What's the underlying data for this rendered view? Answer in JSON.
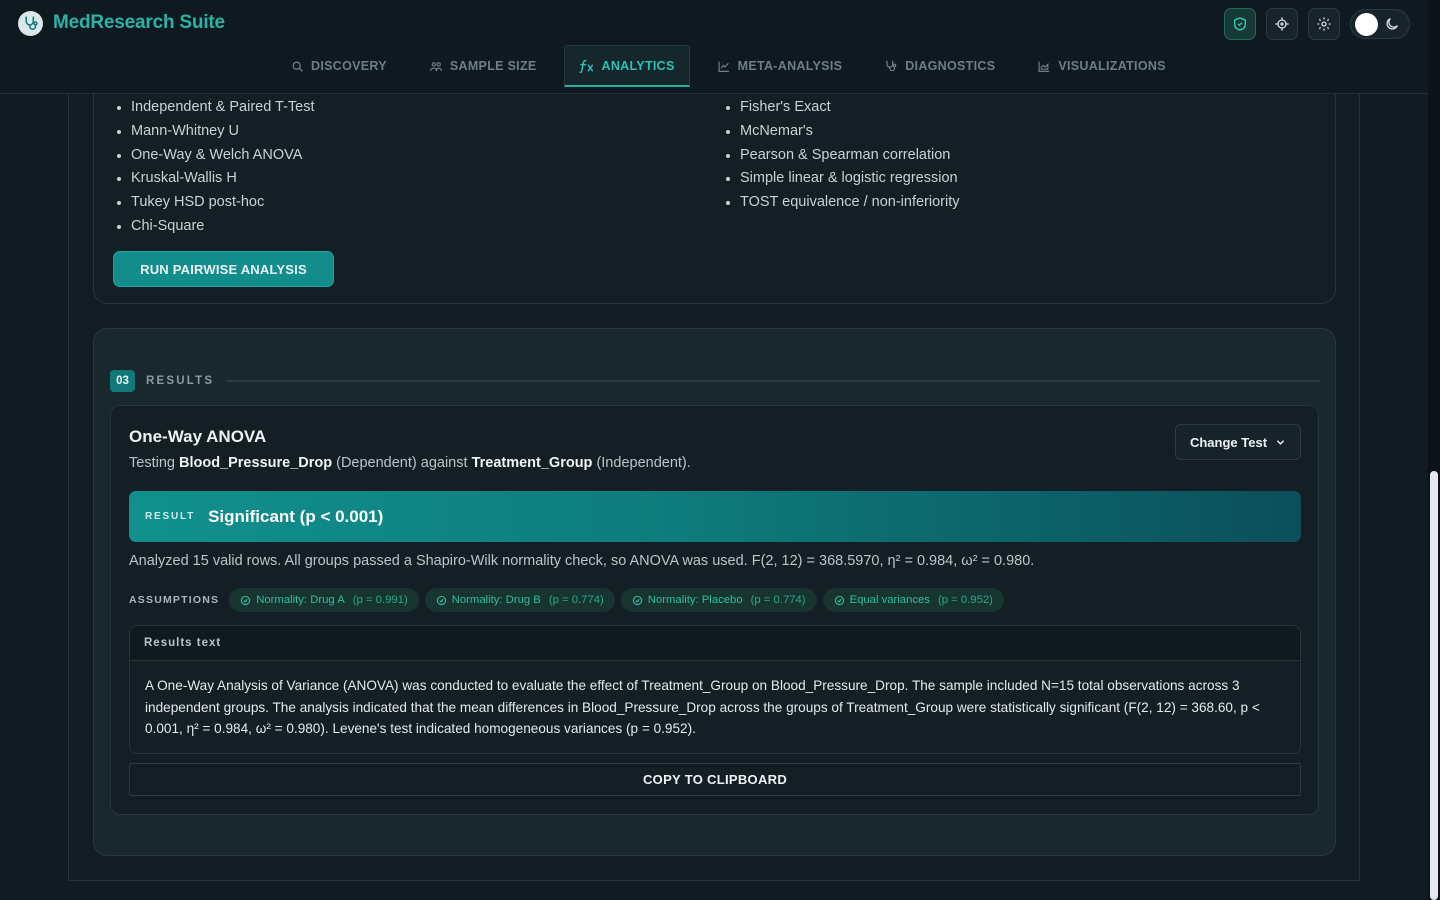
{
  "app": {
    "title": "MedResearch Suite"
  },
  "nav": {
    "tabs": [
      {
        "label": "DISCOVERY",
        "icon": "search-icon",
        "active": false
      },
      {
        "label": "SAMPLE SIZE",
        "icon": "users-icon",
        "active": false
      },
      {
        "label": "ANALYTICS",
        "icon": "function-icon",
        "active": true
      },
      {
        "label": "META-ANALYSIS",
        "icon": "line-chart-icon",
        "active": false
      },
      {
        "label": "DIAGNOSTICS",
        "icon": "stethoscope-icon",
        "active": false
      },
      {
        "label": "VISUALIZATIONS",
        "icon": "area-chart-icon",
        "active": false
      }
    ]
  },
  "header_actions": {
    "shield": "shield-icon",
    "target": "crosshair-icon",
    "settings": "gear-icon",
    "theme": "moon-icon"
  },
  "tests": {
    "left": [
      "Independent & Paired T-Test",
      "Mann-Whitney U",
      "One-Way & Welch ANOVA",
      "Kruskal-Wallis H",
      "Tukey HSD post-hoc",
      "Chi-Square"
    ],
    "right": [
      "Fisher's Exact",
      "McNemar's",
      "Pearson & Spearman correlation",
      "Simple linear & logistic regression",
      "TOST equivalence / non-inferiority"
    ],
    "run_button": "RUN PAIRWISE ANALYSIS"
  },
  "results": {
    "section_number": "03",
    "section_label": "RESULTS",
    "test_name": "One-Way ANOVA",
    "desc_prefix": "Testing",
    "dependent_var": "Blood_Pressure_Drop",
    "desc_dependent": "(Dependent) against",
    "independent_var": "Treatment_Group",
    "desc_independent": "(Independent).",
    "change_test_label": "Change Test",
    "banner_label": "RESULT",
    "banner_value": "Significant (p < 0.001)",
    "analyzed_text": "Analyzed 15 valid rows. All groups passed a Shapiro-Wilk normality check, so ANOVA was used. F(2, 12) = 368.5970, η² = 0.984, ω² = 0.980.",
    "assumptions_label": "ASSUMPTIONS",
    "assumptions": [
      {
        "label": "Normality: Drug A",
        "p": "(p = 0.991)"
      },
      {
        "label": "Normality: Drug B",
        "p": "(p = 0.774)"
      },
      {
        "label": "Normality: Placebo",
        "p": "(p = 0.774)"
      },
      {
        "label": "Equal variances",
        "p": "(p = 0.952)"
      }
    ],
    "results_text_label": "Results text",
    "results_text": "A One-Way Analysis of Variance (ANOVA) was conducted to evaluate the effect of Treatment_Group on Blood_Pressure_Drop. The sample included N=15 total observations across 3 independent groups. The analysis indicated that the mean differences in Blood_Pressure_Drop across the groups of Treatment_Group were statistically significant (F(2, 12) = 368.60, p < 0.001, η² = 0.984, ω² = 0.980). Levene's test indicated homogeneous variances (p = 0.952).",
    "copy_label": "COPY TO CLIPBOARD"
  },
  "colors": {
    "accent": "#2bb3a8",
    "button": "#138d8b",
    "chip_text": "#2bbfa3"
  }
}
